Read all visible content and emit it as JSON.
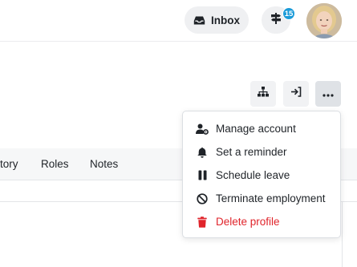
{
  "header": {
    "inbox_label": "Inbox",
    "notification_count": "15"
  },
  "toolbar": {
    "buttons": [
      {
        "icon": "org-chart-icon"
      },
      {
        "icon": "sign-in-icon"
      },
      {
        "icon": "more-options-icon"
      }
    ]
  },
  "tabs": [
    {
      "label": "tory"
    },
    {
      "label": "Roles"
    },
    {
      "label": "Notes"
    }
  ],
  "menu": {
    "items": [
      {
        "label": "Manage account",
        "icon": "user-settings-icon"
      },
      {
        "label": "Set a reminder",
        "icon": "bell-icon"
      },
      {
        "label": "Schedule leave",
        "icon": "pause-icon"
      },
      {
        "label": "Terminate employment",
        "icon": "ban-icon"
      },
      {
        "label": "Delete profile",
        "icon": "trash-icon",
        "color": "#e0242b"
      }
    ]
  },
  "colors": {
    "accent_badge": "#1b9bd8",
    "danger": "#e0242b"
  }
}
